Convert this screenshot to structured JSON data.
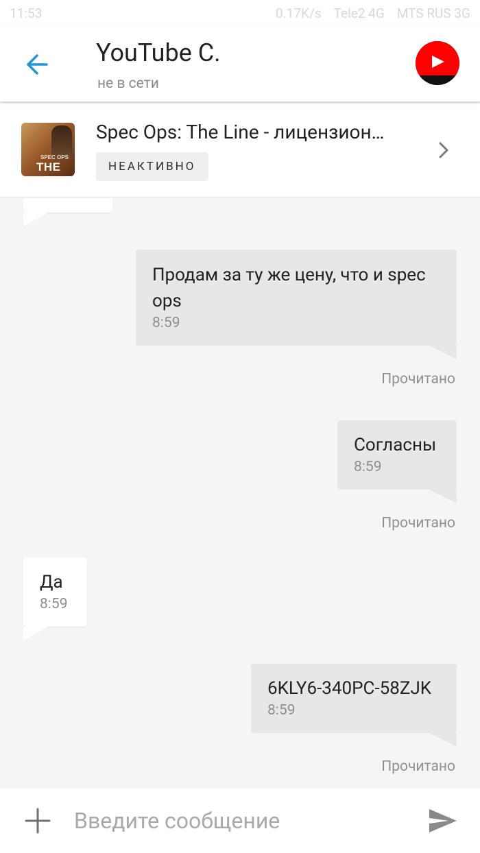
{
  "status_bar": {
    "time": "11:53",
    "network_speed": "0.17K/s",
    "carrier1": "Tele2 4G",
    "carrier2": "MTS RUS 3G"
  },
  "header": {
    "contact_name": "YouTube С.",
    "contact_status": "не в сети",
    "back_icon": "arrow-left-icon",
    "avatar_icon": "youtube-logo"
  },
  "listing": {
    "title": "Spec Ops: The Line - лицензион…",
    "badge": "НЕАКТИВНО",
    "thumbnail_text_small": "SPEC OPS",
    "thumbnail_text_large": "THE LI"
  },
  "messages": [
    {
      "direction": "in",
      "text": "",
      "time": ""
    },
    {
      "direction": "out",
      "text": "Продам за ту же цену, что и spec ops",
      "time": "8:59",
      "receipt": "Прочитано"
    },
    {
      "direction": "out",
      "text": "Согласны",
      "time": "8:59",
      "receipt": "Прочитано"
    },
    {
      "direction": "in",
      "text": "Да",
      "time": "8:59"
    },
    {
      "direction": "out",
      "text": "6KLY6-340PC-58ZJK",
      "time": "8:59",
      "receipt": "Прочитано"
    }
  ],
  "composer": {
    "placeholder": "Введите сообщение",
    "value": ""
  },
  "colors": {
    "accent_blue": "#2196d3",
    "youtube_red": "#ff0000",
    "bubble_out": "#e7e7e7",
    "bubble_in": "#ffffff",
    "chat_bg": "#f5f5f5"
  }
}
